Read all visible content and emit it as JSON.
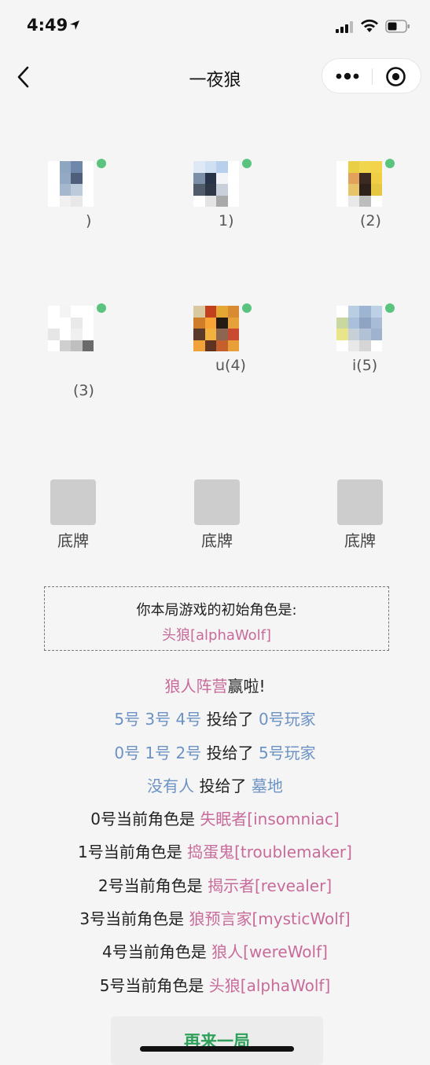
{
  "status_bar": {
    "time": "4:49"
  },
  "nav": {
    "title": "一夜狼"
  },
  "players": [
    {
      "label": ")",
      "avatar_colors": [
        "#ffffff",
        "#8fa6c0",
        "#6f87a8",
        "#ffffff",
        "#ffffff",
        "#94a9c4",
        "#4d5f7b",
        "#ffffff",
        "#ffffff",
        "#a5b7cd",
        "#bccbdc",
        "#ffffff",
        "#ffffff",
        "#f0f0f0",
        "#e8e8e8",
        "#ffffff"
      ]
    },
    {
      "label": "1)",
      "avatar_colors": [
        "#dfe9f5",
        "#cfe0f2",
        "#b8d0ec",
        "#ffffff",
        "#7b8fa9",
        "#273449",
        "#f2f4f8",
        "#ffffff",
        "#505b6b",
        "#2f3846",
        "#c9d0da",
        "#ffffff",
        "#ffffff",
        "#e4e4e4",
        "#a9a9a9",
        "#ffffff"
      ]
    },
    {
      "label": "(2)",
      "avatar_colors": [
        "#ffffff",
        "#e8cf45",
        "#efd64c",
        "#f3d34a",
        "#ffffff",
        "#e2a25c",
        "#3a2a22",
        "#f0cf45",
        "#ffffff",
        "#e7c36a",
        "#2d211b",
        "#e7c741",
        "#ffffff",
        "#e8e8e8",
        "#bdbdbd",
        "#ffffff"
      ]
    },
    {
      "label": "(3)",
      "avatar_colors": [
        "#ffffff",
        "#f4f4f4",
        "#ffffff",
        "#ffffff",
        "#ffffff",
        "#ffffff",
        "#e9e9e9",
        "#ffffff",
        "#e6e6e6",
        "#ffffff",
        "#f0f0f0",
        "#ffffff",
        "#ffffff",
        "#cfcfcf",
        "#bfbfbf",
        "#6a6a6a"
      ]
    },
    {
      "label": "u(4)",
      "avatar_colors": [
        "#d8c9a0",
        "#c2401d",
        "#e3a733",
        "#d98b32",
        "#cf7d29",
        "#f7a336",
        "#241b15",
        "#e6a13a",
        "#5a3b2b",
        "#f3b13d",
        "#8c6651",
        "#ca4a31",
        "#f0a239",
        "#5e3321",
        "#c55f2c",
        "#e8a036"
      ]
    },
    {
      "label": "i(5)",
      "avatar_colors": [
        "#ffffff",
        "#b9cde3",
        "#9db5d1",
        "#bdd0e5",
        "#c9d7a0",
        "#aabfdb",
        "#8fa3c2",
        "#a9bcd6",
        "#e9e58a",
        "#c7cfd8",
        "#b2c2d6",
        "#9fb3cf",
        "#ffffff",
        "#e8e8e8",
        "#d6d6d6",
        "#ffffff"
      ]
    }
  ],
  "center_cards": [
    {
      "label": "底牌"
    },
    {
      "label": "底牌"
    },
    {
      "label": "底牌"
    }
  ],
  "initial_role": {
    "prompt": "你本局游戏的初始角色是:",
    "role": "头狼[alphaWolf]"
  },
  "results": {
    "winner_team": "狼人阵营",
    "winner_suffix": "赢啦!",
    "votes": [
      {
        "voters": "5号 3号 4号",
        "verb": "投给了",
        "target": "0号玩家"
      },
      {
        "voters": "0号 1号 2号",
        "verb": "投给了",
        "target": "5号玩家"
      },
      {
        "voters": "没有人",
        "verb": "投给了",
        "target": "墓地"
      }
    ],
    "current_roles": [
      {
        "prefix": "0号当前角色是",
        "role": "失眠者[insomniac]"
      },
      {
        "prefix": "1号当前角色是",
        "role": "捣蛋鬼[troublemaker]"
      },
      {
        "prefix": "2号当前角色是",
        "role": "揭示者[revealer]"
      },
      {
        "prefix": "3号当前角色是",
        "role": "狼预言家[mysticWolf]"
      },
      {
        "prefix": "4号当前角色是",
        "role": "狼人[wereWolf]"
      },
      {
        "prefix": "5号当前角色是",
        "role": "头狼[alphaWolf]"
      }
    ]
  },
  "replay_button": {
    "label": "再来一局"
  },
  "colors": {
    "accent_pink": "#c86b9a",
    "accent_blue": "#6d92c4",
    "online_green": "#5ac47f",
    "button_green": "#2fa05a"
  }
}
